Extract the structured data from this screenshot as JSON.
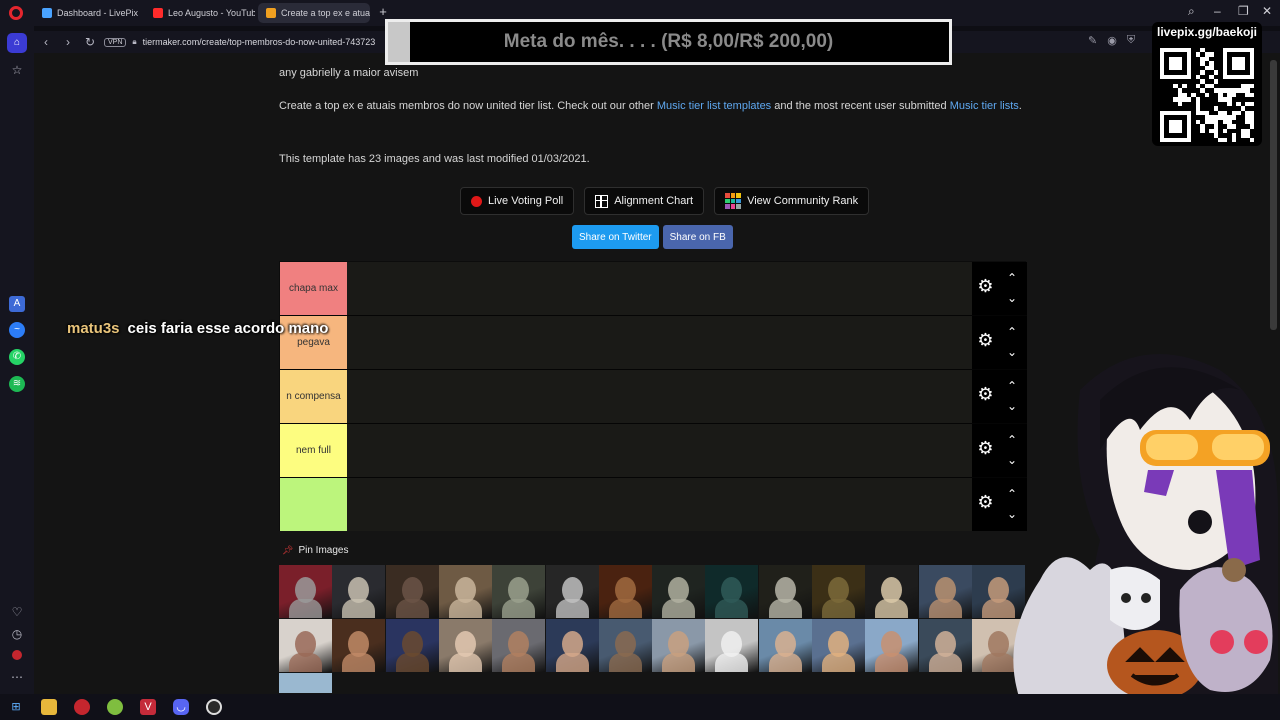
{
  "browser": {
    "tabs": [
      {
        "title": "Dashboard - LivePix",
        "color": "#4aa3ff"
      },
      {
        "title": "Leo Augusto - YouTube",
        "color": "#ff2b2b"
      },
      {
        "title": "Create a top ex e atuais m",
        "color": "#f0a020"
      }
    ],
    "new_tab": "+",
    "url": "tiermaker.com/create/top-membros-do-now-united-743723",
    "vpn": "VPN"
  },
  "page": {
    "intro": "any gabrielly a maior avisem",
    "desc_before": "Create a top ex e atuais membros do now united tier list. Check out our other ",
    "desc_link1": "Music tier list templates",
    "desc_middle": " and the most recent user submitted ",
    "desc_link2": "Music tier lists",
    "desc_end": ".",
    "template_info": "This template has 23 images and was last modified 01/03/2021.",
    "buttons": {
      "live_voting": "Live Voting Poll",
      "alignment": "Alignment Chart",
      "community_rank": "View Community Rank",
      "share_twitter": "Share on Twitter",
      "share_fb": "Share on FB"
    },
    "tiers": [
      {
        "label": "chapa max",
        "color": "#f08080"
      },
      {
        "label": "pegava",
        "color": "#f6b67e"
      },
      {
        "label": "n compensa",
        "color": "#f9d57e"
      },
      {
        "label": "nem full",
        "color": "#fdfd80"
      },
      {
        "label": "",
        "color": "#bcf57c"
      }
    ],
    "pin_images_label": "Pin Images",
    "thumb_colors": [
      [
        "#7a1f2a",
        "#9a9a9a"
      ],
      [
        "#2a2b30",
        "#c8c0b0"
      ],
      [
        "#3a2c22",
        "#6b5446"
      ],
      [
        "#6e5a44",
        "#c9b59b"
      ],
      [
        "#3d4238",
        "#9aa08d"
      ],
      [
        "#262626",
        "#bfbfbf"
      ],
      [
        "#4a2210",
        "#a06a40"
      ],
      [
        "#1f2420",
        "#b0b0a0"
      ],
      [
        "#0f2a2a",
        "#2f5a58"
      ],
      [
        "#20201a",
        "#b7b5a8"
      ],
      [
        "#3b2f16",
        "#7c6a3a"
      ],
      [
        "#1d1d1d",
        "#d9c8a8"
      ],
      [
        "#3a4a60",
        "#b89070"
      ],
      [
        "#2d3c4e",
        "#c49a7a"
      ],
      [
        "#d8d2cc",
        "#9a6a58"
      ],
      [
        "#4a2e1e",
        "#c08a66"
      ],
      [
        "#2a3460",
        "#6a4a30"
      ],
      [
        "#8a7a6a",
        "#e2c8b0"
      ],
      [
        "#6a6a70",
        "#b08060"
      ],
      [
        "#2c3a58",
        "#d4a88a"
      ],
      [
        "#485a70",
        "#8a6a50"
      ],
      [
        "#8a98a8",
        "#c8a080"
      ],
      [
        "#c4c4c4",
        "#f0f0f0"
      ],
      [
        "#6a8aa8",
        "#d8b090"
      ],
      [
        "#5a7090",
        "#e0b080"
      ],
      [
        "#8aa8c8",
        "#c89070"
      ],
      [
        "#3a4a5a",
        "#d0b098"
      ],
      [
        "#d0c0b0",
        "#a07860"
      ],
      [
        "#7890a8",
        "#c8a890"
      ]
    ]
  },
  "overlay": {
    "goal_text": "Meta do mês. . . . (R$ 8,00/R$ 200,00)",
    "goal_progress": 0.04,
    "qr_label": "livepix.gg/baekoji",
    "chat_user": "matu3s",
    "chat_message": "ceis faria esse acordo mano"
  }
}
